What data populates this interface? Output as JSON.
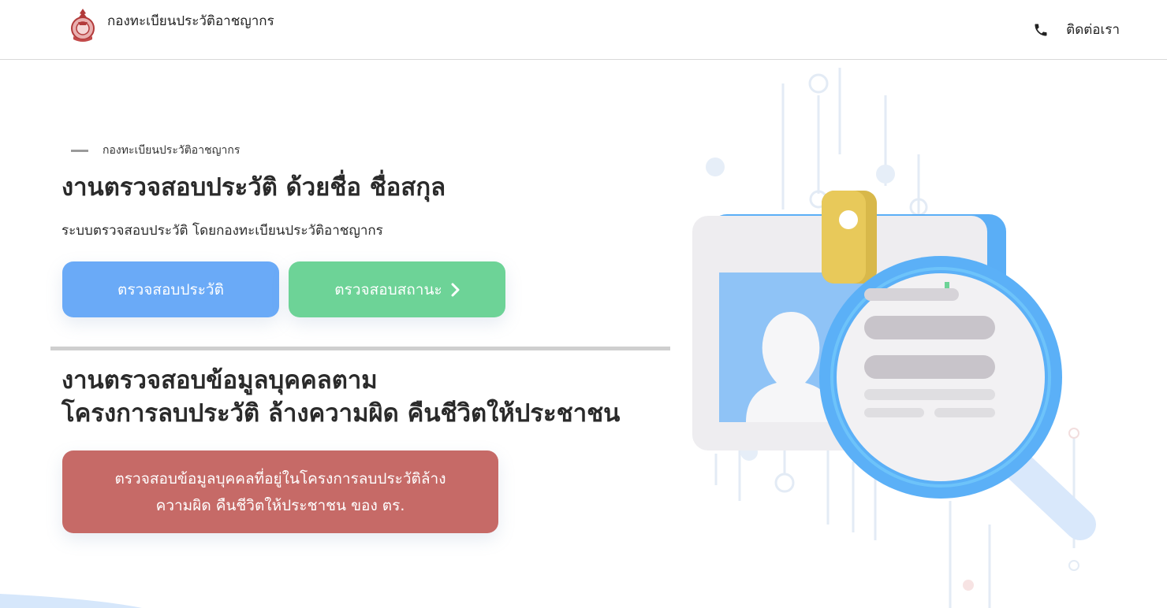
{
  "header": {
    "brand_name": "กองทะเบียนประวัติอาชญากร",
    "contact_label": "ติดต่อเรา"
  },
  "hero": {
    "eyebrow": "กองทะเบียนประวัติอาชญากร",
    "title": "งานตรวจสอบประวัติ ด้วยชื่อ ชื่อสกุล",
    "subtitle": "ระบบตรวจสอบประวัติ โดยกองทะเบียนประวัติอาชญากร",
    "check_history_button": "ตรวจสอบประวัติ",
    "check_status_button": "ตรวจสอบสถานะ"
  },
  "project": {
    "title_line1": "งานตรวจสอบข้อมูลบุคคลตาม",
    "title_line2": "โครงการลบประวัติ ล้างความผิด คืนชีวิตให้ประชาชน",
    "button_line1": "ตรวจสอบข้อมูลบุคคลที่อยู่ในโครงการลบประวัติล้าง",
    "button_line2": "ความผิด คืนชีวิตให้ประชาชน ของ ตร."
  },
  "colors": {
    "history_button": "#6aaaf7",
    "status_button": "#6dd397",
    "project_button": "#c66a67",
    "divider": "#cfcfcf"
  },
  "icons": {
    "logo": "police-emblem-icon",
    "phone": "phone-icon",
    "chevron": "chevron-right-icon",
    "illustration": "id-card-magnifier-illustration"
  }
}
